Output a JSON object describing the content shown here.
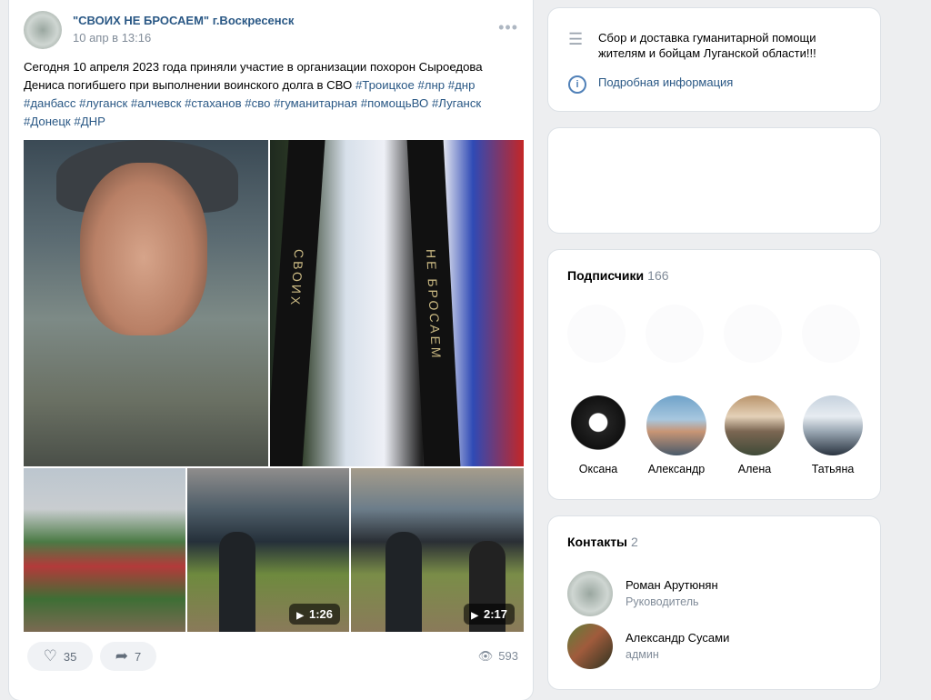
{
  "post": {
    "group_name": "\"СВОИХ НЕ БРОСАЕМ\" г.Воскресенск",
    "date": "10 апр в 13:16",
    "text_plain": "Сегодня 10 апреля 2023 года приняли участие в организации похорон Сыроедова Дениса погибшего при выполнении воинского долга в СВО",
    "hashtags": [
      "#Троицкое",
      "#лнр",
      "#днр",
      "#данбасс",
      "#луганск",
      "#алчевск",
      "#стаханов",
      "#сво",
      "#гуманитарная",
      "#помощьВО",
      "#Луганск",
      "#Донецк",
      "#ДНР"
    ],
    "photo_ribbon_left": "СВОИХ",
    "photo_ribbon_right": "НЕ БРОСАЕМ",
    "videos": [
      {
        "duration": "1:26"
      },
      {
        "duration": "2:17"
      }
    ],
    "likes": "35",
    "shares": "7",
    "views": "593"
  },
  "description": {
    "text": "Сбор и доставка гуманитарной помощи жителям и бойцам Луганской области!!!",
    "more_link": "Подробная информация"
  },
  "subscribers": {
    "title": "Подписчики",
    "count": "166",
    "items": [
      {
        "name": "Оксана"
      },
      {
        "name": "Александр"
      },
      {
        "name": "Алена"
      },
      {
        "name": "Татьяна"
      }
    ]
  },
  "contacts": {
    "title": "Контакты",
    "count": "2",
    "items": [
      {
        "name": "Роман Арутюнян",
        "role": "Руководитель"
      },
      {
        "name": "Александр Сусами",
        "role": "админ"
      }
    ]
  },
  "colors": {
    "background": "#edeef0",
    "link": "#2a5885",
    "secondary_text": "#818c99"
  }
}
